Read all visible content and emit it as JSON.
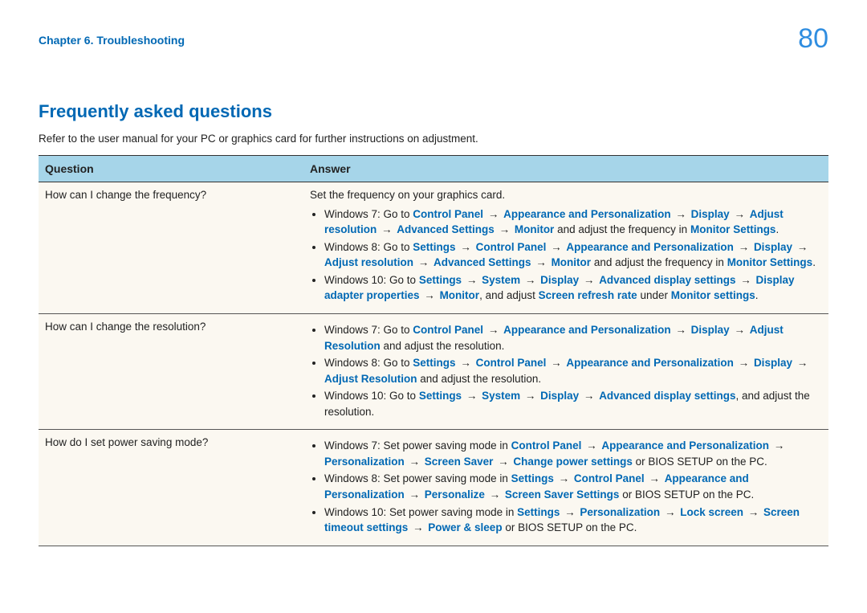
{
  "header": {
    "chapter": "Chapter 6. Troubleshooting",
    "page": "80"
  },
  "title": "Frequently asked questions",
  "intro": "Refer to the user manual for your PC or graphics card for further instructions on adjustment.",
  "table": {
    "head_q": "Question",
    "head_a": "Answer",
    "rows": [
      {
        "question": "How can I change the frequency?",
        "lead": "Set the frequency on your graphics card.",
        "items": [
          [
            {
              "t": "Windows 7: Go to "
            },
            {
              "t": "Control Panel",
              "b": 1
            },
            {
              "a": 1
            },
            {
              "t": "Appearance and Personalization",
              "b": 1
            },
            {
              "a": 1
            },
            {
              "t": "Display",
              "b": 1
            },
            {
              "a": 1
            },
            {
              "t": "Adjust resolution",
              "b": 1
            },
            {
              "a": 1
            },
            {
              "t": "Advanced Settings",
              "b": 1
            },
            {
              "a": 1
            },
            {
              "t": "Monitor",
              "b": 1
            },
            {
              "t": " and adjust the frequency in "
            },
            {
              "t": "Monitor Settings",
              "b": 1
            },
            {
              "t": "."
            }
          ],
          [
            {
              "t": "Windows 8: Go to "
            },
            {
              "t": "Settings",
              "b": 1
            },
            {
              "a": 1
            },
            {
              "t": "Control Panel",
              "b": 1
            },
            {
              "a": 1
            },
            {
              "t": "Appearance and Personalization",
              "b": 1
            },
            {
              "a": 1
            },
            {
              "t": "Display",
              "b": 1
            },
            {
              "a": 1
            },
            {
              "t": "Adjust resolution",
              "b": 1
            },
            {
              "a": 1
            },
            {
              "t": "Advanced Settings",
              "b": 1
            },
            {
              "a": 1
            },
            {
              "t": "Monitor",
              "b": 1
            },
            {
              "t": " and adjust the frequency in "
            },
            {
              "t": "Monitor Settings",
              "b": 1
            },
            {
              "t": "."
            }
          ],
          [
            {
              "t": "Windows 10: Go to "
            },
            {
              "t": "Settings",
              "b": 1
            },
            {
              "a": 1
            },
            {
              "t": "System",
              "b": 1
            },
            {
              "a": 1
            },
            {
              "t": "Display",
              "b": 1
            },
            {
              "a": 1
            },
            {
              "t": "Advanced display settings",
              "b": 1
            },
            {
              "a": 1
            },
            {
              "t": "Display adapter properties",
              "b": 1
            },
            {
              "a": 1
            },
            {
              "t": "Monitor",
              "b": 1
            },
            {
              "t": ", and adjust "
            },
            {
              "t": "Screen refresh rate",
              "b": 1
            },
            {
              "t": " under "
            },
            {
              "t": "Monitor settings",
              "b": 1
            },
            {
              "t": "."
            }
          ]
        ]
      },
      {
        "question": "How can I change the resolution?",
        "items": [
          [
            {
              "t": "Windows 7: Go to "
            },
            {
              "t": "Control Panel",
              "b": 1
            },
            {
              "a": 1
            },
            {
              "t": "Appearance and Personalization",
              "b": 1
            },
            {
              "a": 1
            },
            {
              "t": "Display",
              "b": 1
            },
            {
              "a": 1
            },
            {
              "t": "Adjust Resolution",
              "b": 1
            },
            {
              "t": " and adjust the resolution."
            }
          ],
          [
            {
              "t": "Windows 8: Go to "
            },
            {
              "t": "Settings",
              "b": 1
            },
            {
              "a": 1
            },
            {
              "t": "Control Panel",
              "b": 1
            },
            {
              "a": 1
            },
            {
              "t": "Appearance and Personalization",
              "b": 1
            },
            {
              "a": 1
            },
            {
              "t": "Display",
              "b": 1
            },
            {
              "a": 1
            },
            {
              "t": "Adjust Resolution",
              "b": 1
            },
            {
              "t": " and adjust the resolution."
            }
          ],
          [
            {
              "t": "Windows 10: Go to "
            },
            {
              "t": "Settings",
              "b": 1
            },
            {
              "a": 1
            },
            {
              "t": "System",
              "b": 1
            },
            {
              "a": 1
            },
            {
              "t": "Display",
              "b": 1
            },
            {
              "a": 1
            },
            {
              "t": "Advanced display settings",
              "b": 1
            },
            {
              "t": ", and adjust the resolution."
            }
          ]
        ]
      },
      {
        "question": "How do I set power saving mode?",
        "items": [
          [
            {
              "t": "Windows 7: Set power saving mode in "
            },
            {
              "t": "Control Panel",
              "b": 1
            },
            {
              "a": 1
            },
            {
              "t": "Appearance and Personalization",
              "b": 1
            },
            {
              "a": 1
            },
            {
              "t": "Personalization",
              "b": 1
            },
            {
              "a": 1
            },
            {
              "t": "Screen Saver",
              "b": 1
            },
            {
              "a": 1
            },
            {
              "t": "Change power settings",
              "b": 1
            },
            {
              "t": " or BIOS SETUP on the PC."
            }
          ],
          [
            {
              "t": "Windows 8: Set power saving mode in "
            },
            {
              "t": "Settings",
              "b": 1
            },
            {
              "a": 1
            },
            {
              "t": "Control Panel",
              "b": 1
            },
            {
              "a": 1
            },
            {
              "t": "Appearance and Personalization",
              "b": 1
            },
            {
              "a": 1
            },
            {
              "t": "Personalize",
              "b": 1
            },
            {
              "a": 1
            },
            {
              "t": "Screen Saver Settings",
              "b": 1
            },
            {
              "t": " or BIOS SETUP on the PC."
            }
          ],
          [
            {
              "t": "Windows 10: Set power saving mode in "
            },
            {
              "t": "Settings",
              "b": 1
            },
            {
              "a": 1
            },
            {
              "t": "Personalization",
              "b": 1
            },
            {
              "a": 1
            },
            {
              "t": "Lock screen",
              "b": 1
            },
            {
              "a": 1
            },
            {
              "t": "Screen timeout settings",
              "b": 1
            },
            {
              "a": 1
            },
            {
              "t": "Power & sleep",
              "b": 1
            },
            {
              "t": " or BIOS SETUP on the PC."
            }
          ]
        ]
      }
    ]
  },
  "arrow": "→"
}
